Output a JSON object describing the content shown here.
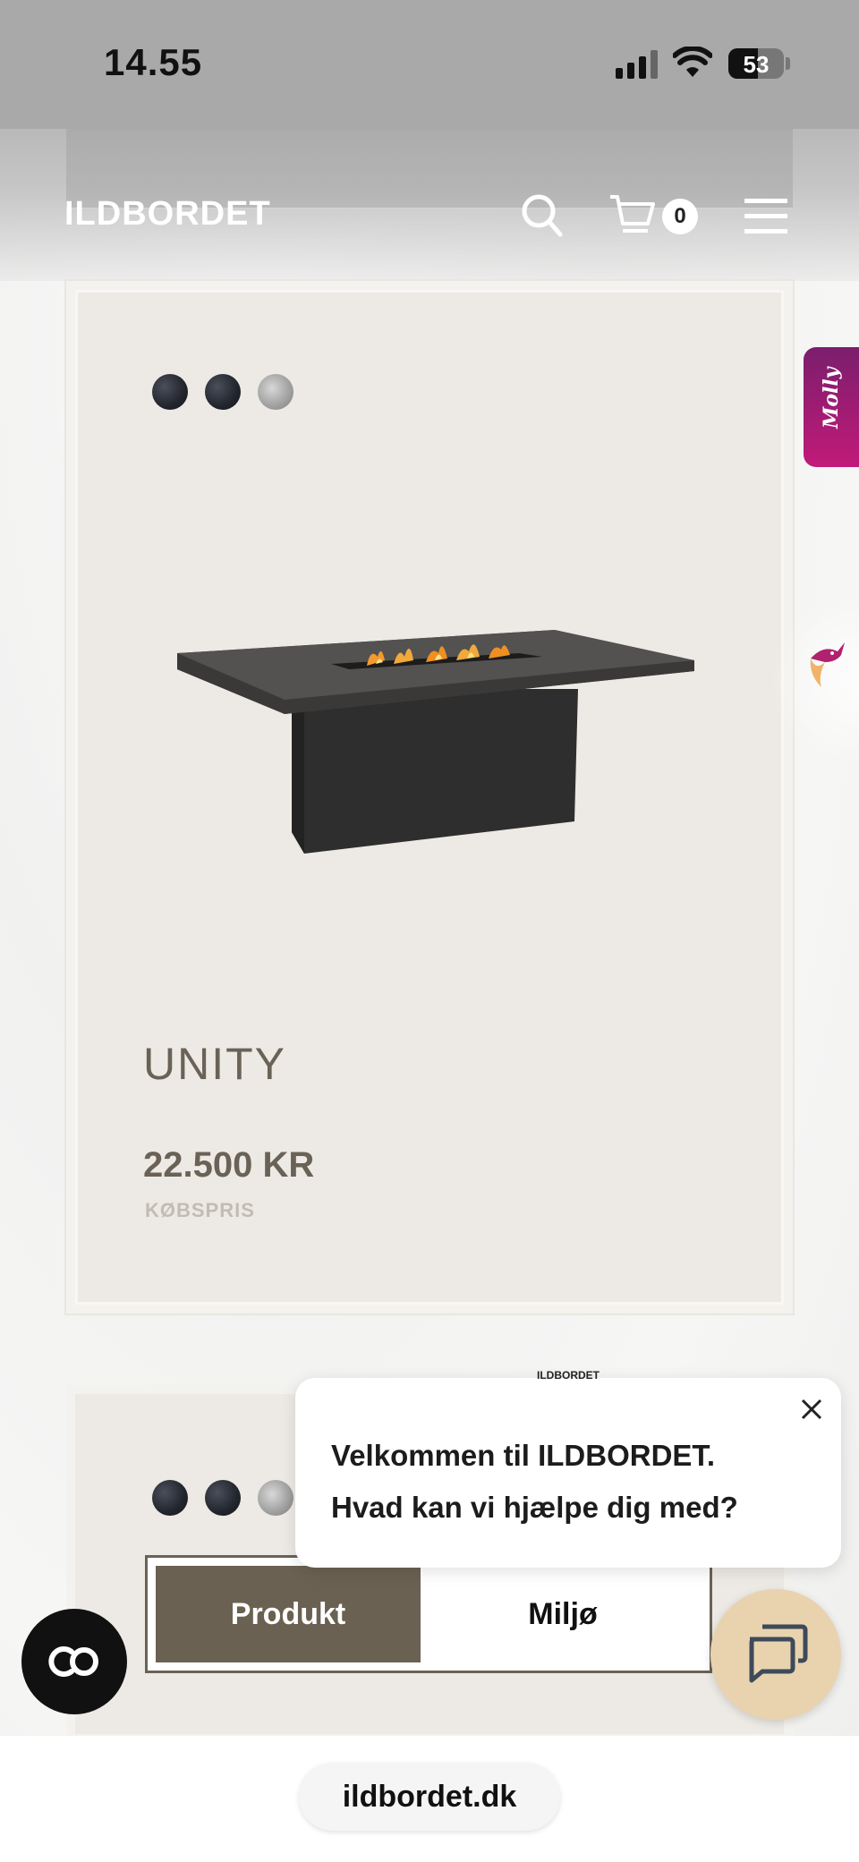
{
  "status_bar": {
    "time": "14.55",
    "battery": "53"
  },
  "header": {
    "logo": "ILDBORDET",
    "cart_count": "0"
  },
  "product": {
    "title": "UNITY",
    "price": "22.500 KR",
    "price_label": "KØBSPRIS",
    "swatches": [
      "dark",
      "dark",
      "steel"
    ]
  },
  "side_widget": {
    "label": "Molly"
  },
  "second_product": {
    "toggle": {
      "active": "Produkt",
      "inactive": "Miljø"
    }
  },
  "chat": {
    "brand": "ILDBORDET",
    "line1": "Velkommen til ILDBORDET.",
    "line2": "Hvad kan vi hjælpe dig med?"
  },
  "browser": {
    "url": "ildbordet.dk"
  }
}
